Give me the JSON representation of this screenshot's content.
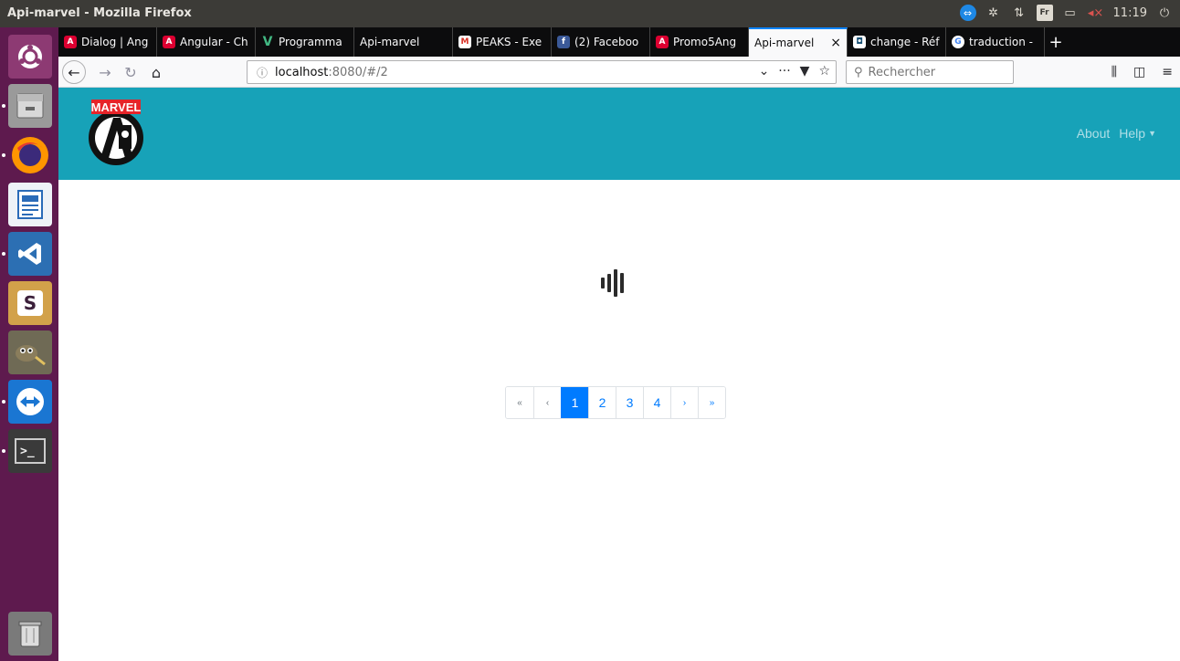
{
  "window": {
    "title": "Api-marvel - Mozilla Firefox"
  },
  "tray": {
    "keyboard_layout": "Fr",
    "clock": "11:19"
  },
  "launcher": {
    "items": [
      "ubuntu-dash",
      "files",
      "firefox",
      "libreoffice-writer",
      "vscode",
      "slack",
      "gimp",
      "teamviewer",
      "terminal",
      "trash"
    ]
  },
  "tabs": [
    {
      "label": "Dialog | Ang",
      "icon": "angular-icon"
    },
    {
      "label": "Angular - Ch",
      "icon": "angular-icon"
    },
    {
      "label": "Programma",
      "icon": "vue-icon"
    },
    {
      "label": "Api-marvel",
      "icon": ""
    },
    {
      "label": "PEAKS - Exe",
      "icon": "gmail-icon"
    },
    {
      "label": "(2) Faceboo",
      "icon": "facebook-icon"
    },
    {
      "label": "Promo5Ang",
      "icon": "angular-icon"
    },
    {
      "label": "Api-marvel",
      "icon": "",
      "active": true
    },
    {
      "label": "change - Réf",
      "icon": "reference-icon"
    },
    {
      "label": "traduction -",
      "icon": "google-icon"
    }
  ],
  "url": {
    "host": "localhost",
    "rest": ":8080/#/2"
  },
  "search": {
    "placeholder": "Rechercher"
  },
  "header": {
    "logo_text": "MARVEL",
    "menu": {
      "about": "About",
      "help": "Help"
    }
  },
  "pagination": {
    "first": "«",
    "prev": "‹",
    "pages": [
      "1",
      "2",
      "3",
      "4"
    ],
    "active_page": "1",
    "next": "›",
    "last": "»"
  },
  "colors": {
    "header_bg": "#17a2b8",
    "accent": "#007bff",
    "launcher_bg": "#5e1a4e"
  }
}
